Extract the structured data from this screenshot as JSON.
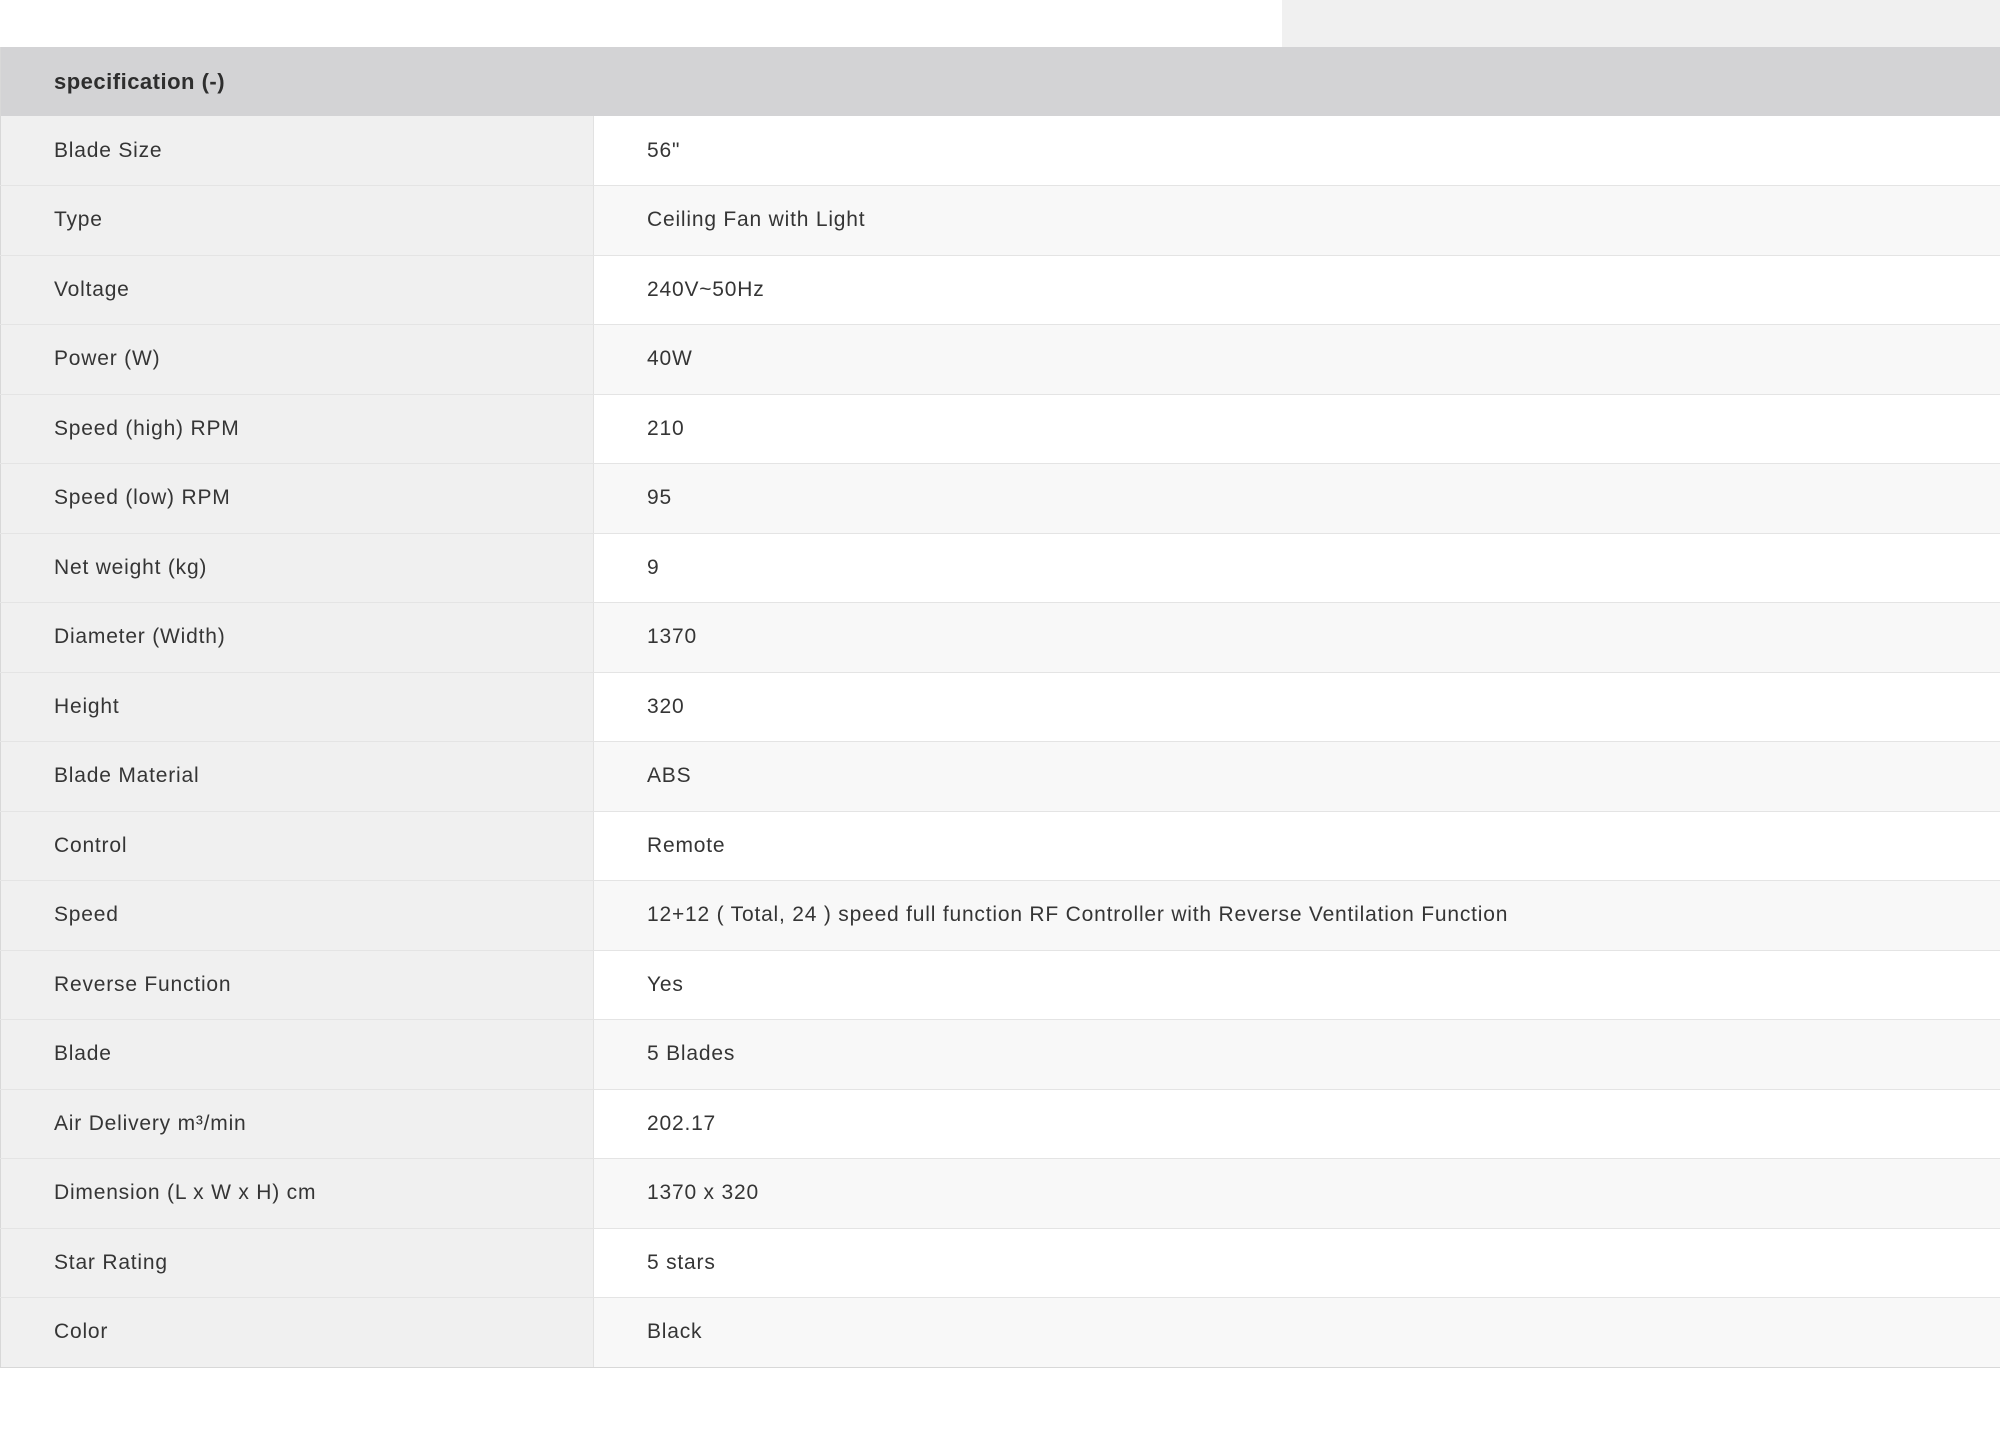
{
  "spec": {
    "title": "specification (-)",
    "rows": [
      {
        "label": "Blade Size",
        "value": "56\""
      },
      {
        "label": "Type",
        "value": "Ceiling Fan with Light"
      },
      {
        "label": "Voltage",
        "value": "240V~50Hz"
      },
      {
        "label": "Power (W)",
        "value": "40W"
      },
      {
        "label": "Speed (high) RPM",
        "value": "210"
      },
      {
        "label": "Speed (low) RPM",
        "value": "95"
      },
      {
        "label": "Net weight (kg)",
        "value": "9"
      },
      {
        "label": "Diameter (Width)",
        "value": "1370"
      },
      {
        "label": "Height",
        "value": "320"
      },
      {
        "label": "Blade Material",
        "value": "ABS"
      },
      {
        "label": "Control",
        "value": "Remote"
      },
      {
        "label": "Speed",
        "value": "12+12 ( Total, 24 ) speed full function RF Controller with Reverse Ventilation Function"
      },
      {
        "label": "Reverse Function",
        "value": "Yes"
      },
      {
        "label": "Blade",
        "value": "5 Blades"
      },
      {
        "label": "Air Delivery m³/min",
        "value": "202.17"
      },
      {
        "label": "Dimension (L x W x H) cm",
        "value": "1370 x 320"
      },
      {
        "label": "Star Rating",
        "value": "5 stars"
      },
      {
        "label": "Color",
        "value": "Black"
      }
    ]
  }
}
